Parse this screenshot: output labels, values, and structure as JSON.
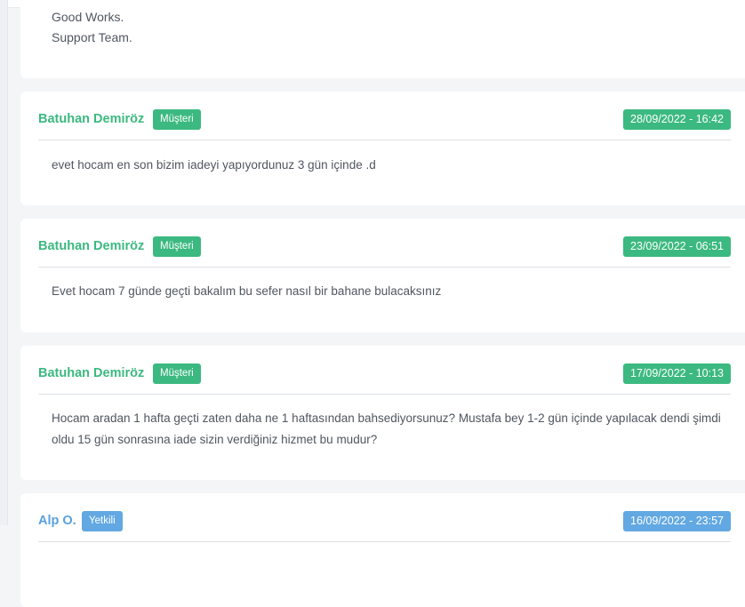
{
  "signature": {
    "line1": "Good Works.",
    "line2": "Support Team."
  },
  "messages": [
    {
      "author": "Batuhan Demiröz",
      "role": "Müşteri",
      "datetime": "28/09/2022 - 16:42",
      "body": "evet hocam en son bizim iadeyi yapıyordunuz 3 gün içinde .d"
    },
    {
      "author": "Batuhan Demiröz",
      "role": "Müşteri",
      "datetime": "23/09/2022 - 06:51",
      "body": "Evet hocam 7 günde geçti bakalım bu sefer nasıl bir bahane bulacaksınız"
    },
    {
      "author": "Batuhan Demiröz",
      "role": "Müşteri",
      "datetime": "17/09/2022 - 10:13",
      "body": "Hocam aradan 1 hafta geçti zaten daha ne 1 haftasından bahsediyorsunuz? Mustafa bey 1-2 gün içinde yapılacak dendi şimdi oldu 15 gün sonrasına iade sizin verdiğiniz hizmet bu mudur?"
    },
    {
      "author": "Alp O.",
      "role": "Yetkili",
      "datetime": "16/09/2022 - 23:57",
      "body": ""
    }
  ],
  "colors": {
    "customer_accent": "#3cb980",
    "staff_accent": "#62a8e2"
  }
}
